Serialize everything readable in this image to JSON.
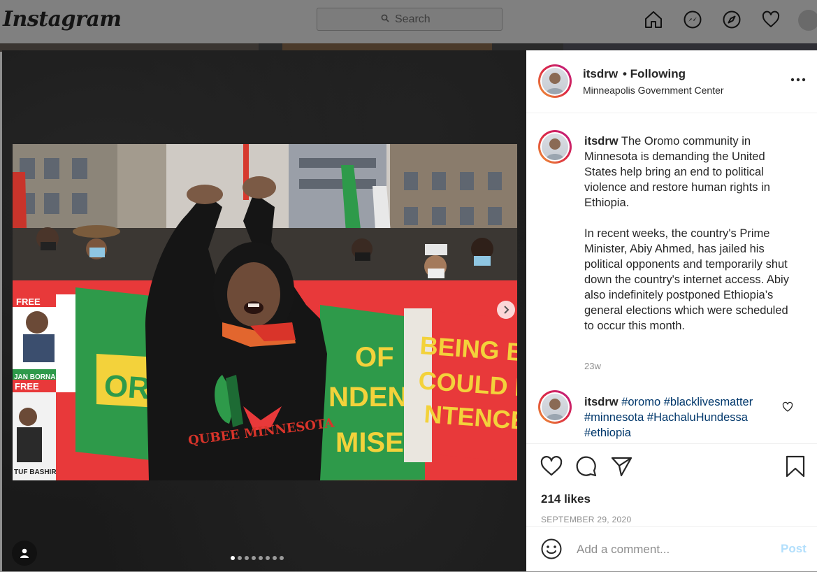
{
  "topbar": {
    "logo": "Instagram",
    "search_placeholder": "Search"
  },
  "post": {
    "author": "itsdrw",
    "follow_status": "• Following",
    "location": "Minneapolis Government Center",
    "caption_paragraph_1": "The Oromo community in Minnesota is demanding the United States help bring an end to political violence and restore human rights in Ethiopia.",
    "caption_paragraph_2": "In recent weeks, the country's Prime Minister, Abiy Ahmed, has jailed his political opponents and temporarily shut down the country's internet access. Abiy also indefinitely postponed Ethiopia’s general elections which were scheduled to occur this month.",
    "caption_time": "23w",
    "comment": {
      "author": "itsdrw",
      "hashtags": [
        "#oromo",
        "#blacklivesmatter",
        "#minnesota",
        "#HachaluHundessa",
        "#ethiopia"
      ]
    },
    "likes": "214 likes",
    "date": "SEPTEMBER 29, 2020",
    "carousel": {
      "count": 8,
      "active_index": 0
    },
    "photo_text": {
      "banner_left": "OROMO",
      "banner_mid": "OF\nNDENC\nMISE",
      "banner_right": "BEING BO\nCOULD NOT\nNTENCE",
      "shirt": "QUBEE MINNESOTA",
      "poster_free_1": "FREE",
      "poster_free_2": "FREE",
      "poster_name_1": "JAN BORNA",
      "poster_name_2": "TUF BASHIR"
    }
  },
  "comment_box": {
    "placeholder": "Add a comment...",
    "post_label": "Post"
  },
  "colors": {
    "hashtag": "#00376b",
    "post_disabled": "#b2dffc",
    "banner_red": "#e8393a",
    "banner_green": "#2e9a4a",
    "banner_yellow": "#f3d23b"
  }
}
